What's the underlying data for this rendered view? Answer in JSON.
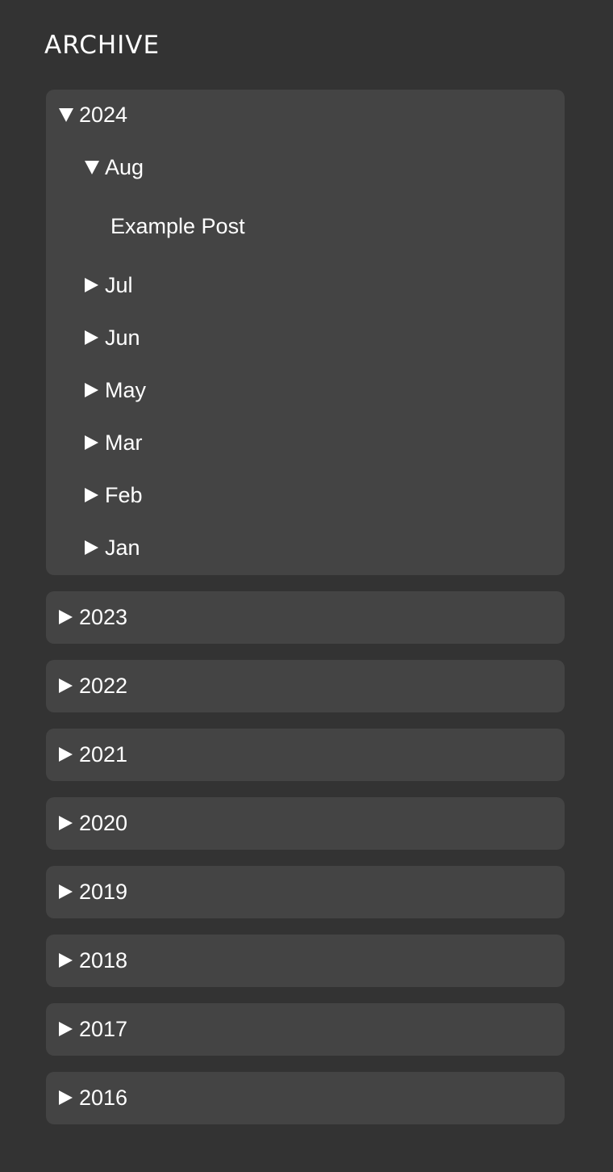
{
  "sidebar": {
    "title": "ARCHIVE",
    "expanded_year": {
      "label": "2024",
      "expanded_month": {
        "label": "Aug",
        "posts": [
          "Example Post"
        ]
      },
      "collapsed_months": [
        "Jul",
        "Jun",
        "May",
        "Mar",
        "Feb",
        "Jan"
      ]
    },
    "collapsed_years": [
      "2023",
      "2022",
      "2021",
      "2020",
      "2019",
      "2018",
      "2017",
      "2016"
    ]
  },
  "colors": {
    "background": "#333333",
    "panel": "#444444",
    "text": "#ffffff"
  }
}
